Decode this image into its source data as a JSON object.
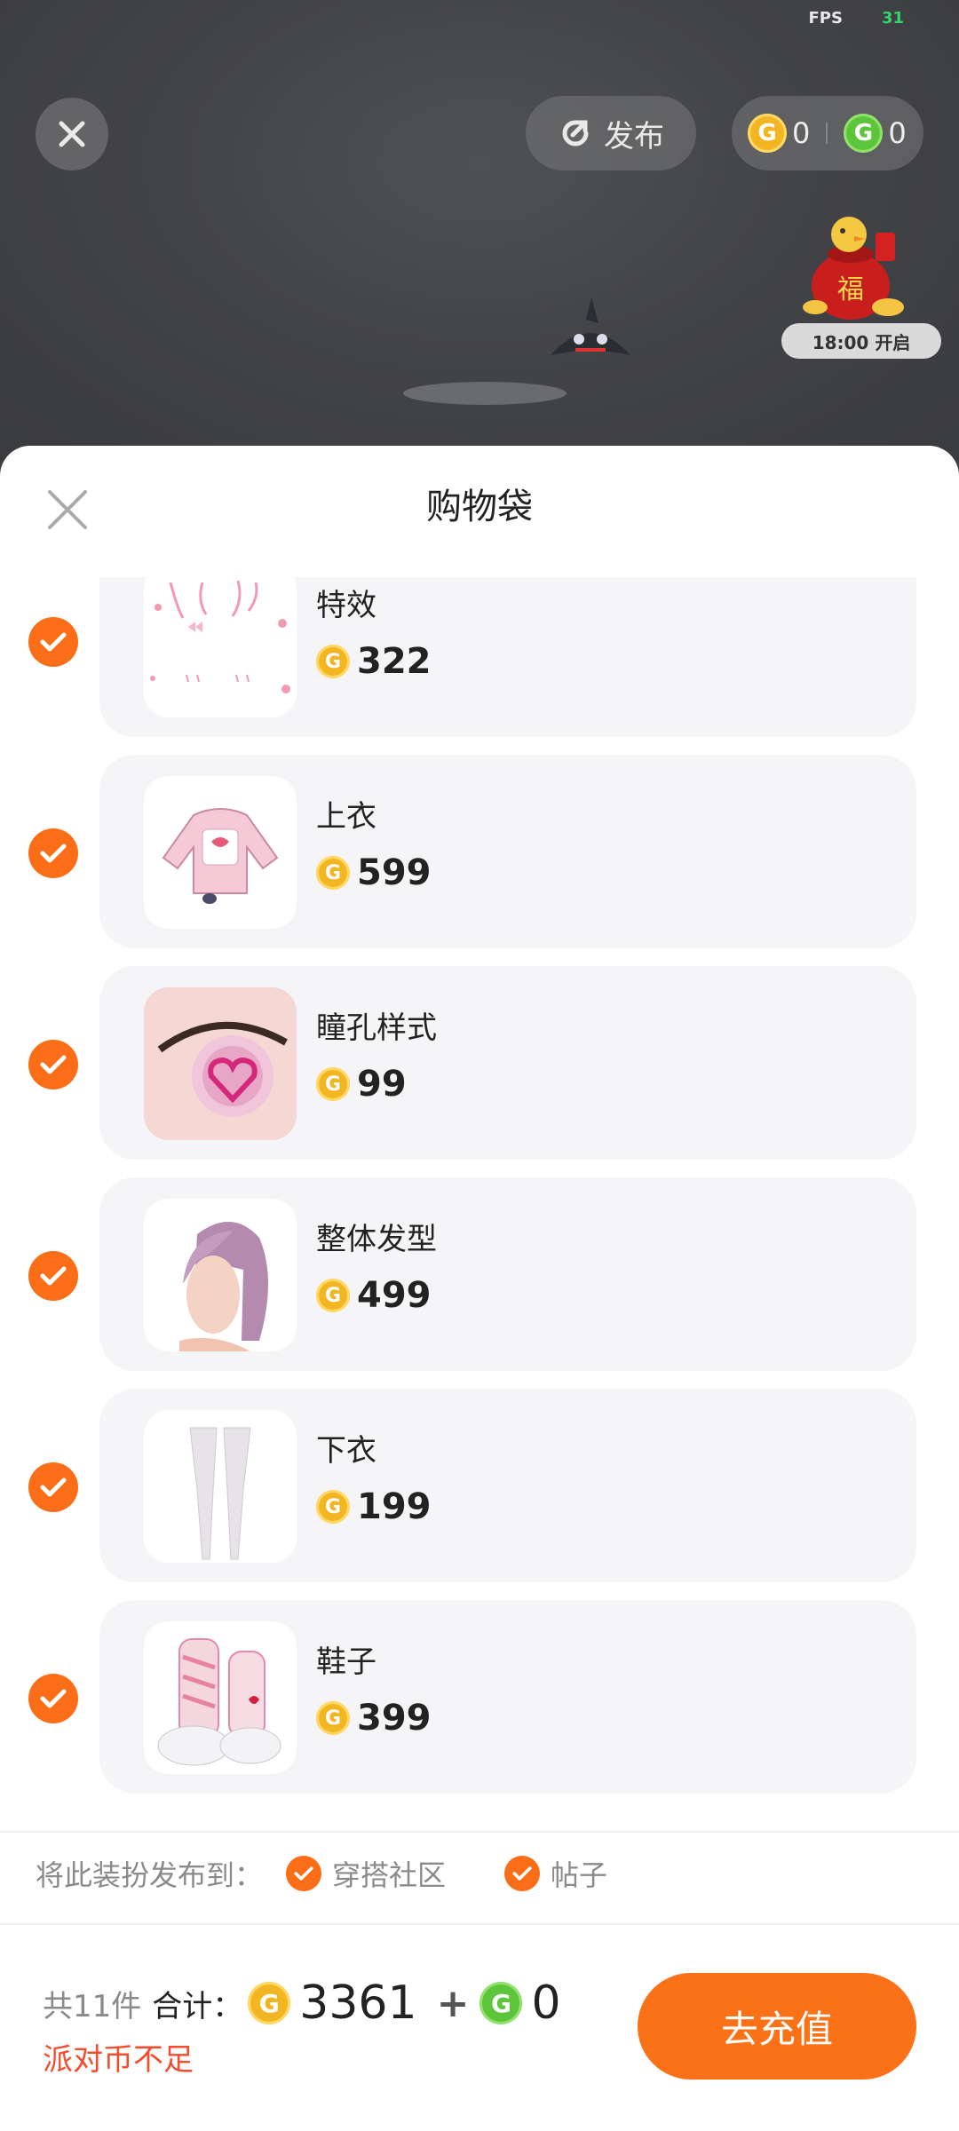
{
  "scene": {
    "fps_label": "FPS",
    "fps_value": "31",
    "publish_label": "发布",
    "gold_balance": "0",
    "green_balance": "0",
    "event_time": "18:00 开启",
    "event_char": "福"
  },
  "sheet": {
    "title": "购物袋",
    "items": [
      {
        "name": "特效",
        "price": "322"
      },
      {
        "name": "上衣",
        "price": "599"
      },
      {
        "name": "瞳孔样式",
        "price": "99"
      },
      {
        "name": "整体发型",
        "price": "499"
      },
      {
        "name": "下衣",
        "price": "199"
      },
      {
        "name": "鞋子",
        "price": "399"
      }
    ],
    "publish_to_label": "将此装扮发布到：",
    "publish_options": [
      "穿搭社区",
      "帖子"
    ]
  },
  "footer": {
    "count_label": "共11件",
    "total_label": "合计：",
    "gold_total": "3361",
    "plus": "+",
    "green_total": "0",
    "warning": "派对币不足",
    "recharge_label": "去充值"
  },
  "colors": {
    "accent": "#fb6d16",
    "warning": "#f24d2e",
    "gold_coin": "#f3b623",
    "green_coin": "#5cc53a"
  },
  "icons": [
    "close-icon",
    "publish-icon",
    "gold-coin-icon",
    "green-coin-icon",
    "check-icon"
  ]
}
